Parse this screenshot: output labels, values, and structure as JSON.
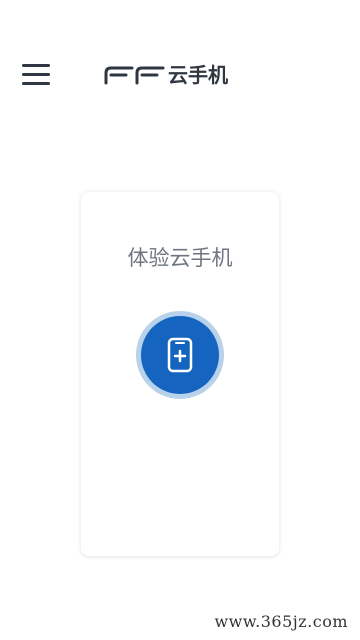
{
  "header": {
    "menu_icon": "hamburger-menu-icon",
    "logo_text": "云手机",
    "logo_mark_icon": "ff-logo-icon"
  },
  "card": {
    "title": "体验云手机",
    "action_icon": "phone-add-icon",
    "accent_color": "#1565c0",
    "accent_ring_color": "#b9d2ec"
  },
  "watermark": {
    "text": "www.365jz.com"
  },
  "colors": {
    "text_dark": "#2f3742",
    "text_muted": "#6d7682",
    "background": "#ffffff"
  }
}
